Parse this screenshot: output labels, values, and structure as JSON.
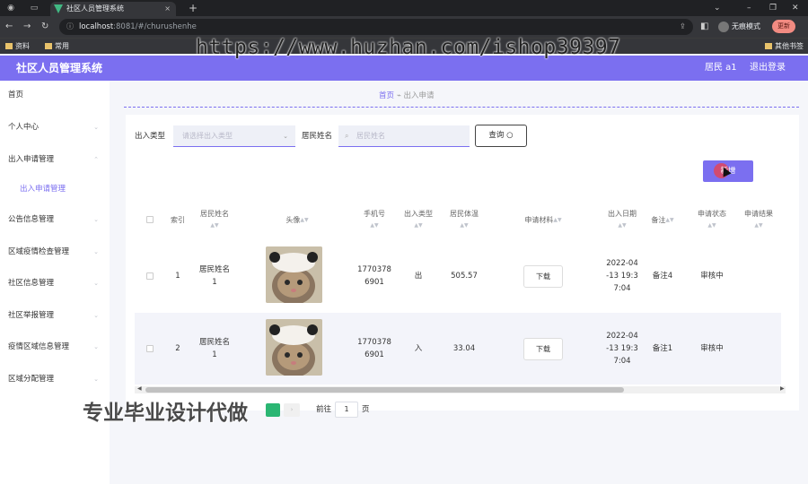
{
  "browser": {
    "tab_title": "社区人员管理系统",
    "url_host": "localhost",
    "url_path": ":8081/#/churushenhe",
    "incognito_label": "无痕模式",
    "update_label": "更新",
    "bookmarks": [
      "资料",
      "常用",
      "其他书签"
    ]
  },
  "watermark": {
    "url": "https://www.huzhan.com/ishop39397",
    "text": "专业毕业设计代做"
  },
  "header": {
    "title": "社区人员管理系统",
    "user": "居民 a1",
    "logout": "退出登录"
  },
  "sidebar": {
    "items": [
      {
        "label": "首页",
        "expandable": false
      },
      {
        "label": "个人中心",
        "expandable": true
      },
      {
        "label": "出入申请管理",
        "expandable": true
      },
      {
        "label": "出入申请管理",
        "expandable": false,
        "sub": true
      },
      {
        "label": "公告信息管理",
        "expandable": true
      },
      {
        "label": "区域疫情检查管理",
        "expandable": true
      },
      {
        "label": "社区信息管理",
        "expandable": true
      },
      {
        "label": "社区举报管理",
        "expandable": true
      },
      {
        "label": "疫情区域信息管理",
        "expandable": true
      },
      {
        "label": "区域分配管理",
        "expandable": true
      }
    ]
  },
  "breadcrumb": {
    "home": "首页",
    "current": "出入申请"
  },
  "search": {
    "type_label": "出入类型",
    "type_placeholder": "请选择出入类型",
    "name_label": "居民姓名",
    "name_placeholder": "居民姓名",
    "query_label": "查询"
  },
  "add_label": "新增",
  "table": {
    "headers": [
      "索引",
      "居民姓名",
      "头像",
      "手机号",
      "出入类型",
      "居民体温",
      "申请材料",
      "出入日期",
      "备注",
      "申请状态",
      "申请结果"
    ],
    "rows": [
      {
        "index": "1",
        "name": "居民姓名\n1",
        "phone": "1770378\n6901",
        "type": "出",
        "temp": "505.57",
        "material": "下载",
        "date": "2022-04\n-13 19:3\n7:04",
        "note": "备注4",
        "status": "审核中",
        "result": ""
      },
      {
        "index": "2",
        "name": "居民姓名\n1",
        "phone": "1770378\n6901",
        "type": "入",
        "temp": "33.04",
        "material": "下载",
        "date": "2022-04\n-13 19:3\n7:04",
        "note": "备注1",
        "status": "审核中",
        "result": ""
      }
    ]
  },
  "pager": {
    "goto_label": "前往",
    "page": "1",
    "page_unit": "页"
  },
  "colors": {
    "accent": "#7b6ff0",
    "danger": "#e2455a",
    "page_active": "#2bb673"
  }
}
